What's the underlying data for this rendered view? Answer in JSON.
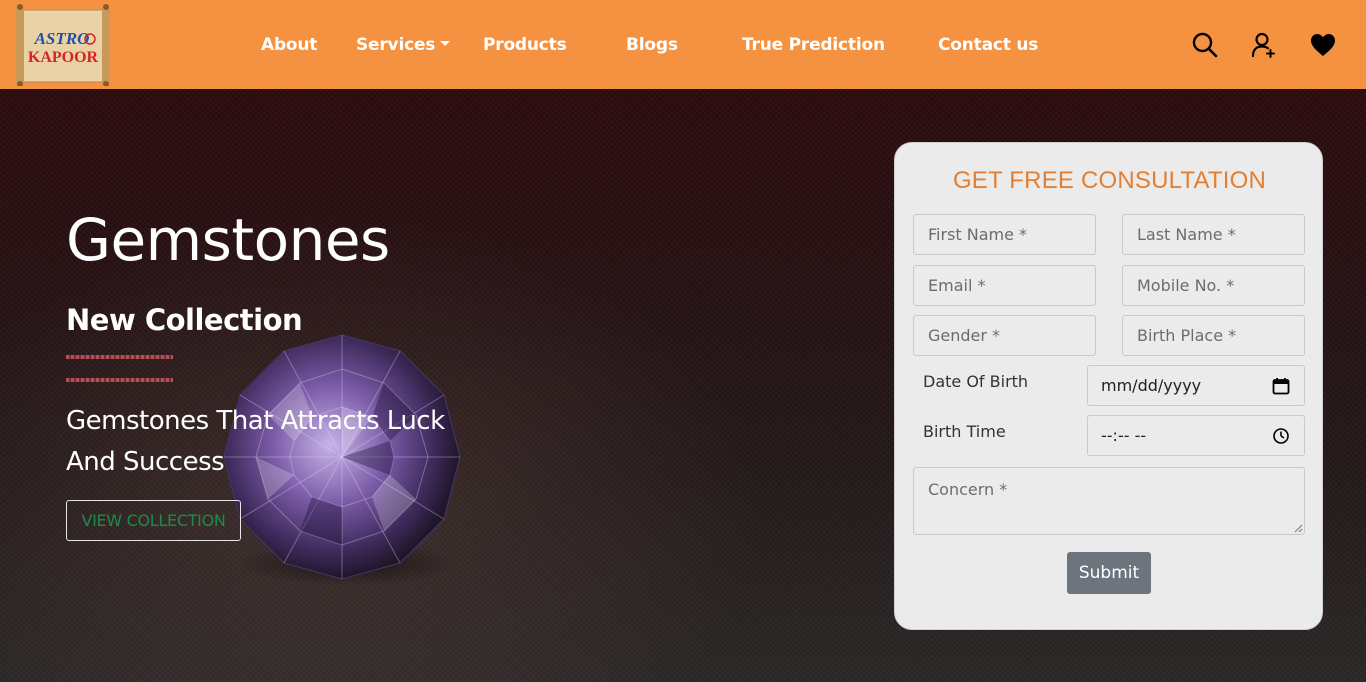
{
  "brand": {
    "logo_line1": "ASTRO",
    "logo_line2": "KAPOOR"
  },
  "nav": {
    "about": "About",
    "services": "Services",
    "products": "Products",
    "blogs": "Blogs",
    "true_prediction": "True Prediction",
    "contact": "Contact us"
  },
  "header_icons": [
    "search-icon",
    "add-user-icon",
    "heart-icon"
  ],
  "hero": {
    "title": "Gemstones",
    "subtitle": "New Collection",
    "description": "Gemstones That Attracts Luck And Success",
    "button": "VIEW COLLECTION"
  },
  "form": {
    "title": "GET FREE CONSULTATION",
    "first_name_placeholder": "First Name *",
    "last_name_placeholder": "Last Name *",
    "email_placeholder": "Email *",
    "mobile_placeholder": "Mobile No. *",
    "gender_placeholder": "Gender *",
    "birth_place_placeholder": "Birth Place *",
    "dob_label": "Date Of Birth",
    "dob_value": "mm/dd/yyyy",
    "birth_time_label": "Birth Time",
    "birth_time_value": "--:-- --",
    "concern_placeholder": "Concern *",
    "submit": "Submit"
  },
  "colors": {
    "header_bg": "#f59241",
    "form_title": "#e27f32",
    "view_button_text": "#1f8a4c",
    "submit_bg": "#6c757d"
  }
}
